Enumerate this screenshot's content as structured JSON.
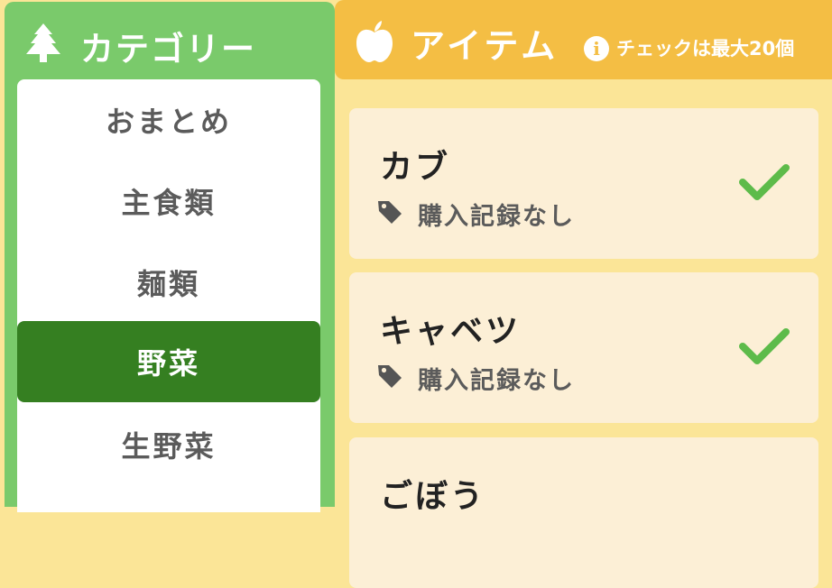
{
  "category_panel": {
    "title": "カテゴリー",
    "icon": "tree-icon",
    "items": [
      {
        "label": "おまとめ",
        "active": false
      },
      {
        "label": "主食類",
        "active": false
      },
      {
        "label": "麺類",
        "active": false
      },
      {
        "label": "野菜",
        "active": true
      },
      {
        "label": "生野菜",
        "active": false
      }
    ]
  },
  "item_panel": {
    "title": "アイテム",
    "icon": "apple-icon",
    "note_icon": "info-icon",
    "note": "チェックは最大20個",
    "items": [
      {
        "name": "カブ",
        "status": "購入記録なし",
        "checked": true
      },
      {
        "name": "キャベツ",
        "status": "購入記録なし",
        "checked": true
      },
      {
        "name": "ごぼう",
        "status": "",
        "checked": false
      }
    ]
  },
  "colors": {
    "category_green": "#7aca6b",
    "active_green": "#357f21",
    "header_orange": "#f4be44",
    "background_yellow": "#fbe597",
    "card_cream": "#fcefd6",
    "check_green": "#5dbb4a"
  }
}
